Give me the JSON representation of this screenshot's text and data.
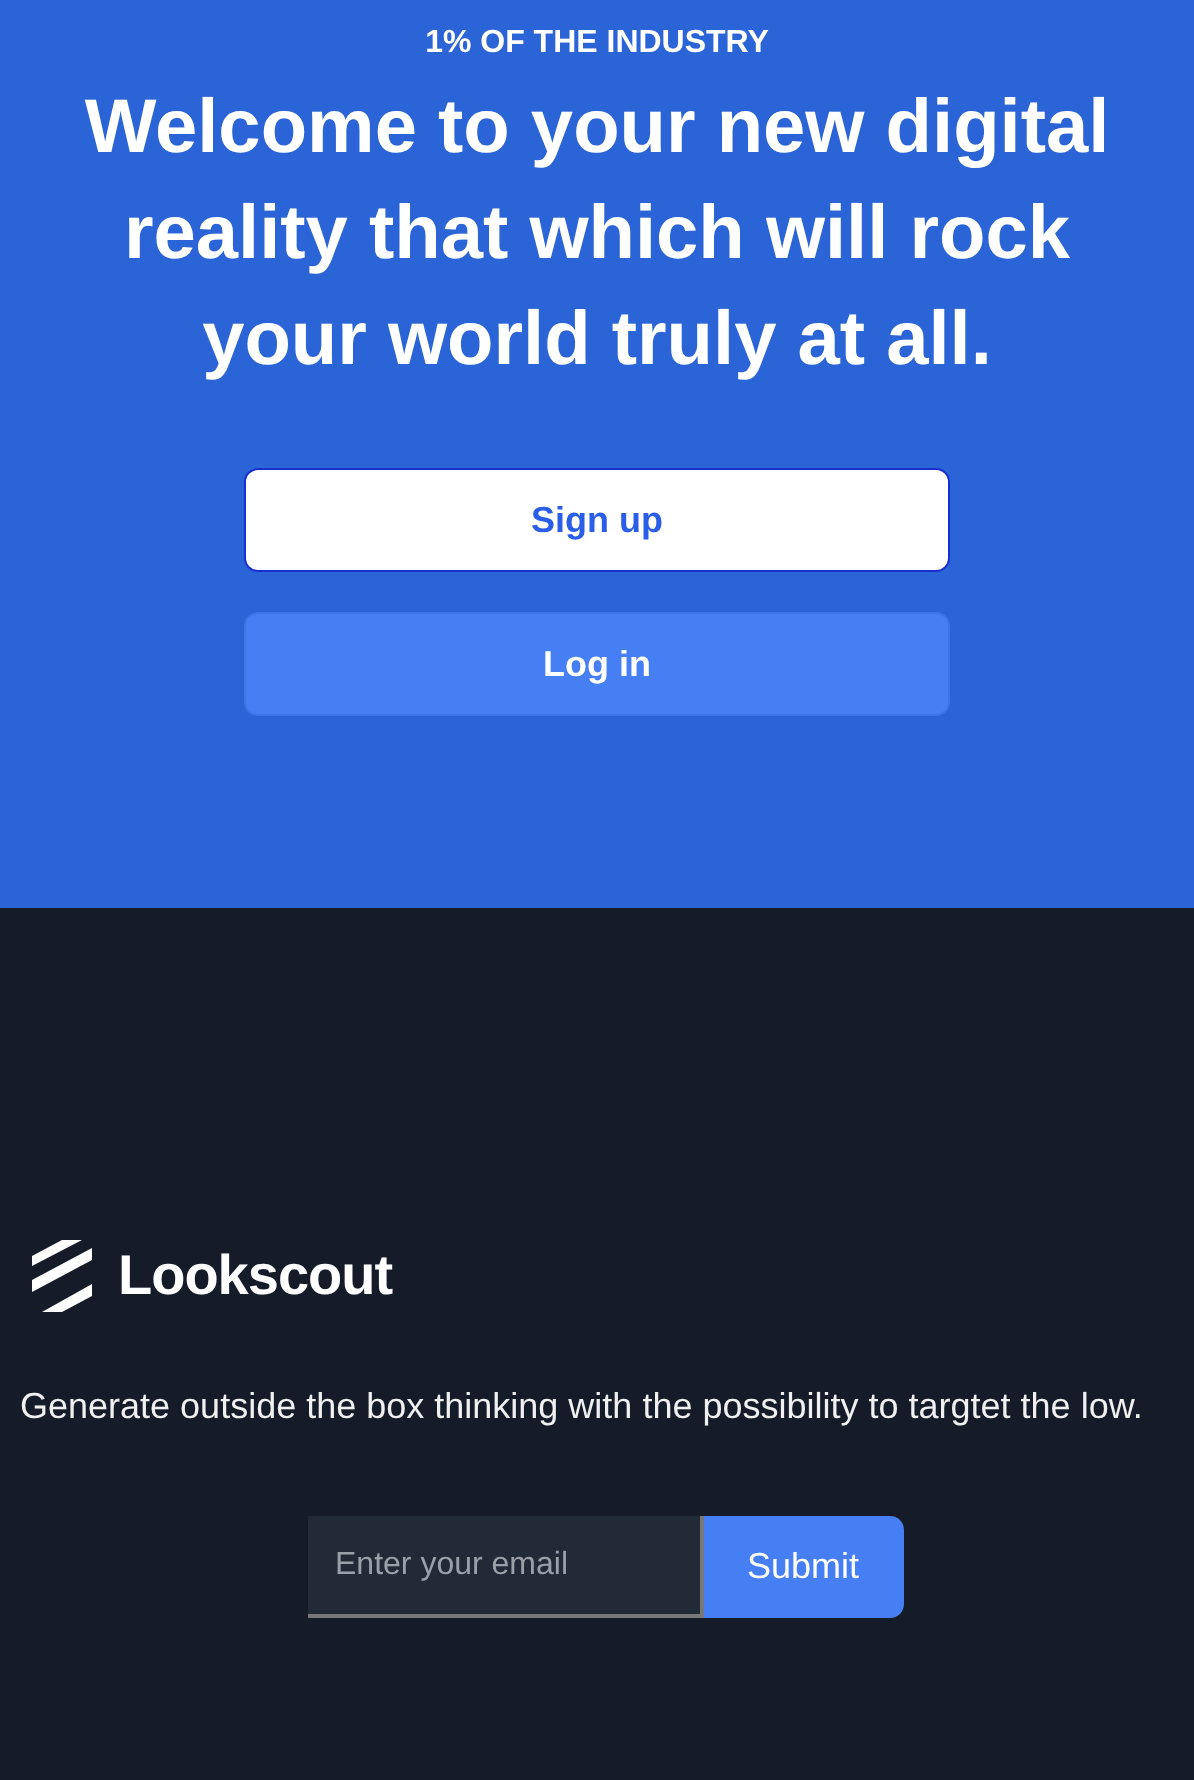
{
  "hero": {
    "eyebrow": "1% OF THE INDUSTRY",
    "heading": "Welcome to your new digital reality that which will rock your world truly at all.",
    "buttons": [
      {
        "label": "Sign up",
        "kind": "primary"
      },
      {
        "label": "Log in",
        "kind": "secondary"
      }
    ]
  },
  "footer": {
    "brand": "Lookscout",
    "description": "Generate outside the box thinking with the possibility to targtet the low.",
    "email": {
      "placeholder": "Enter your email"
    },
    "submit": "Submit"
  }
}
